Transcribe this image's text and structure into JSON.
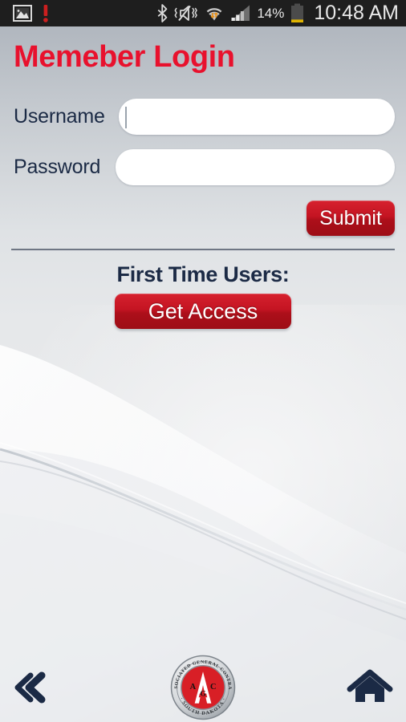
{
  "status_bar": {
    "time": "10:48 AM",
    "battery_percent": "14%",
    "icons": [
      {
        "name": "gallery-image-icon",
        "side": "left"
      },
      {
        "name": "alert-exclamation-icon",
        "side": "left"
      },
      {
        "name": "bluetooth-icon",
        "side": "right"
      },
      {
        "name": "sound-muted-vibrate-icon",
        "side": "right"
      },
      {
        "name": "wifi-icon",
        "side": "right"
      },
      {
        "name": "cellular-signal-icon",
        "side": "right"
      },
      {
        "name": "battery-icon",
        "side": "right"
      }
    ],
    "colors": {
      "background": "#1e1e1e",
      "text": "#e8e8e8",
      "battery_fill": "#e0b400",
      "alert": "#cc1f1f"
    }
  },
  "screen": {
    "title": "Memeber Login"
  },
  "form": {
    "username": {
      "label": "Username",
      "value": "",
      "placeholder": ""
    },
    "password": {
      "label": "Password",
      "value": "",
      "placeholder": ""
    },
    "submit_label": "Submit"
  },
  "first_time": {
    "heading": "First Time Users:",
    "button_label": "Get Access"
  },
  "bottom_nav": {
    "back_icon": "double-chevron-left-icon",
    "home_icon": "home-icon",
    "logo": {
      "name": "agc-south-dakota-logo",
      "outer_text_top": "THE ASSOCIATED GENERAL CONTRACTORS",
      "outer_text_bottom": "SOUTH DAKOTA",
      "letters": [
        "A",
        "G",
        "C"
      ],
      "monogram": "A"
    }
  },
  "colors": {
    "brand_red": "#e8112d",
    "button_red_top": "#d6212e",
    "button_red_bottom": "#9d0d16",
    "navy_text": "#1b2a45",
    "divider": "#6f7684",
    "bg_top": "#aeb4bc",
    "bg_mid": "#e9eaec"
  }
}
